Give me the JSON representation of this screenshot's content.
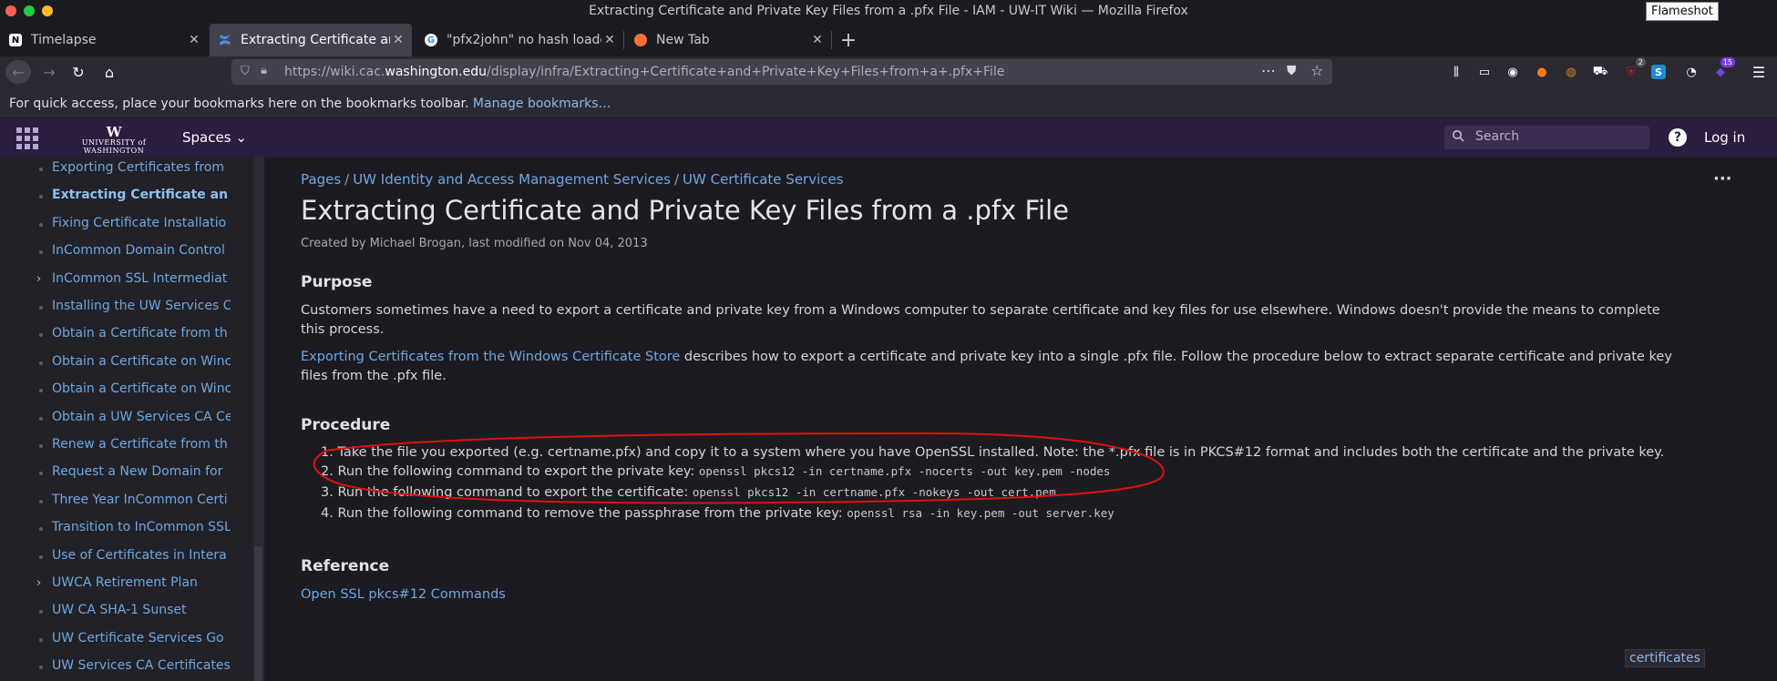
{
  "window": {
    "title": "Extracting Certificate and Private Key Files from a .pfx File - IAM - UW-IT Wiki — Mozilla Firefox"
  },
  "tooltip": "Flameshot",
  "tabs": [
    {
      "label": "Timelapse"
    },
    {
      "label": "Extracting Certificate and"
    },
    {
      "label": "\"pfx2john\" no hash loade"
    },
    {
      "label": "New Tab"
    }
  ],
  "urlbar": {
    "prefix": "https://wiki.cac.",
    "domain": "washington.edu",
    "path": "/display/infra/Extracting+Certificate+and+Private+Key+Files+from+a+.pfx+File"
  },
  "toolbar_badges": {
    "ublock": "2",
    "ext": "15"
  },
  "bookmarks": {
    "text": "For quick access, place your bookmarks here on the bookmarks toolbar.",
    "link": "Manage bookmarks…"
  },
  "confluence": {
    "logo_mark": "W",
    "logo_name": "UNIVERSITY of WASHINGTON",
    "spaces": "Spaces",
    "search_placeholder": "Search",
    "help": "?",
    "login": "Log in"
  },
  "sidebar": {
    "items": [
      {
        "label": "Exporting Certificates from",
        "bold": false,
        "expander": false
      },
      {
        "label": "Extracting Certificate an",
        "bold": true,
        "expander": false
      },
      {
        "label": "Fixing Certificate Installatio",
        "bold": false,
        "expander": false
      },
      {
        "label": "InCommon Domain Control",
        "bold": false,
        "expander": false
      },
      {
        "label": "InCommon SSL Intermediat",
        "bold": false,
        "expander": true
      },
      {
        "label": "Installing the UW Services C",
        "bold": false,
        "expander": false
      },
      {
        "label": "Obtain a Certificate from th",
        "bold": false,
        "expander": false
      },
      {
        "label": "Obtain a Certificate on Winc",
        "bold": false,
        "expander": false
      },
      {
        "label": "Obtain a Certificate on Winc",
        "bold": false,
        "expander": false
      },
      {
        "label": "Obtain a UW Services CA Ce",
        "bold": false,
        "expander": false
      },
      {
        "label": "Renew a Certificate from th",
        "bold": false,
        "expander": false
      },
      {
        "label": "Request a New Domain for",
        "bold": false,
        "expander": false
      },
      {
        "label": "Three Year InCommon Certi",
        "bold": false,
        "expander": false
      },
      {
        "label": "Transition to InCommon SSL",
        "bold": false,
        "expander": false
      },
      {
        "label": "Use of Certificates in Intera",
        "bold": false,
        "expander": false
      },
      {
        "label": "UWCA Retirement Plan",
        "bold": false,
        "expander": true
      },
      {
        "label": "UW CA SHA-1 Sunset",
        "bold": false,
        "expander": false
      },
      {
        "label": "UW Certificate Services Go",
        "bold": false,
        "expander": false
      },
      {
        "label": "UW Services CA Certificates",
        "bold": false,
        "expander": false
      }
    ]
  },
  "page": {
    "breadcrumbs": [
      "Pages",
      "UW Identity and Access Management Services",
      "UW Certificate Services"
    ],
    "title": "Extracting Certificate and Private Key Files from a .pfx File",
    "byline": "Created by Michael Brogan, last modified on Nov 04, 2013",
    "purpose_heading": "Purpose",
    "purpose_text": "Customers sometimes have a need to export a certificate and private key from a Windows computer to separate certificate and key files for use elsewhere. Windows doesn't provide the means to complete this process.",
    "export_link": "Exporting Certificates from the Windows Certificate Store",
    "export_text": " describes how to export a certificate and private key into a single .pfx file. Follow the procedure below  to extract separate certificate and private key files from the .pfx file.",
    "procedure_heading": "Procedure",
    "steps": [
      {
        "text": "1. Take the file you exported (e.g. certname.pfx) and  copy it to a system where you have OpenSSL installed. Note: the *.pfx file is in PKCS#12 format and includes both the certificate and the private key.",
        "code": ""
      },
      {
        "text": "2. Run the following command to export the private key: ",
        "code": "openssl pkcs12 -in certname.pfx -nocerts -out key.pem -nodes"
      },
      {
        "text": "3. Run the following command to export the certificate: ",
        "code": "openssl pkcs12 -in certname.pfx -nokeys -out cert.pem"
      },
      {
        "text": "4. Run the following command to remove the passphrase from the private key: ",
        "code": "openssl rsa -in key.pem -out server.key"
      }
    ],
    "reference_heading": "Reference",
    "reference_link": "Open SSL pkcs#12 Commands",
    "label_tag": "certificates"
  },
  "colors": {
    "annotation": "#e01010",
    "link": "#6fa8e0",
    "header": "#2c1c40"
  }
}
